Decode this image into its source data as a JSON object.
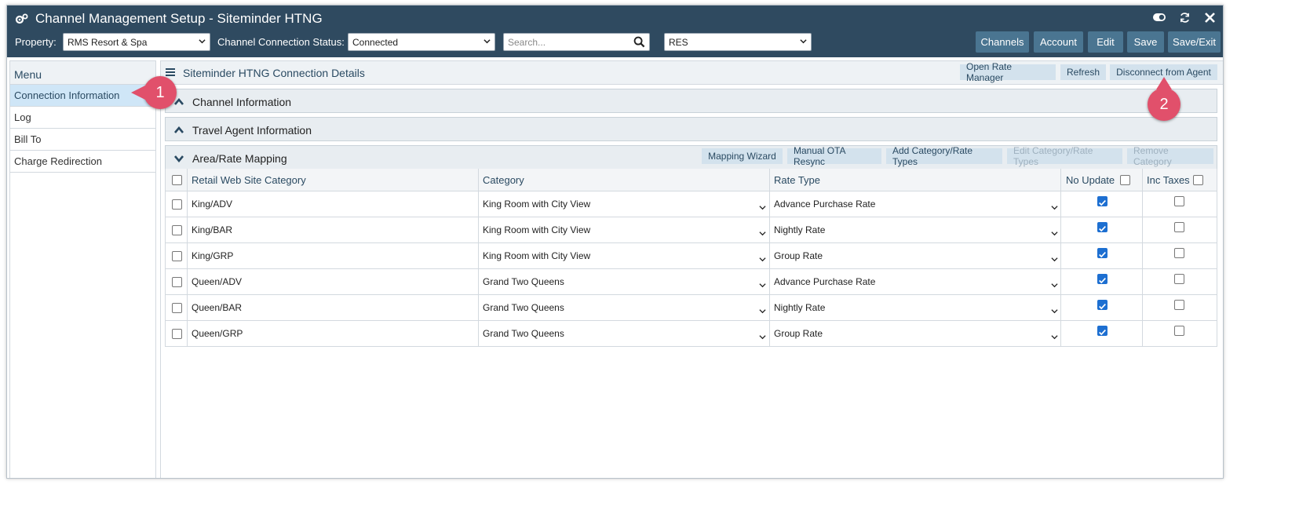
{
  "app": {
    "title": "Channel Management Setup - Siteminder HTNG"
  },
  "toolbar": {
    "property_label": "Property:",
    "property_value": "RMS Resort & Spa",
    "status_label": "Channel Connection Status:",
    "status_value": "Connected",
    "search_placeholder": "Search...",
    "res_value": "RES",
    "buttons": [
      "Channels",
      "Account",
      "Edit",
      "Save",
      "Save/Exit"
    ]
  },
  "sidebar": {
    "title": "Menu",
    "items": [
      {
        "label": "Connection Information"
      },
      {
        "label": "Log"
      },
      {
        "label": "Bill To"
      },
      {
        "label": "Charge Redirection"
      }
    ]
  },
  "main": {
    "title": "Siteminder HTNG Connection Details",
    "header_buttons": [
      "Open Rate Manager",
      "Refresh",
      "Disconnect from Agent"
    ],
    "sections": [
      {
        "title": "Channel Information"
      },
      {
        "title": "Travel Agent Information"
      },
      {
        "title": "Area/Rate Mapping"
      }
    ],
    "mapping_buttons": [
      "Mapping Wizard",
      "Manual OTA Resync",
      "Add Category/Rate Types",
      "Edit Category/Rate Types",
      "Remove Category"
    ],
    "table": {
      "columns": [
        "Retail Web Site Category",
        "Category",
        "Rate Type",
        "No Update",
        "Inc Taxes"
      ],
      "rows": [
        {
          "retail": "King/ADV",
          "category": "King Room with City View",
          "rate": "Advance Purchase Rate",
          "no_update": true,
          "inc_taxes": false
        },
        {
          "retail": "King/BAR",
          "category": "King Room with City View",
          "rate": "Nightly Rate",
          "no_update": true,
          "inc_taxes": false
        },
        {
          "retail": "King/GRP",
          "category": "King Room with City View",
          "rate": "Group Rate",
          "no_update": true,
          "inc_taxes": false
        },
        {
          "retail": "Queen/ADV",
          "category": "Grand Two Queens",
          "rate": "Advance Purchase Rate",
          "no_update": true,
          "inc_taxes": false
        },
        {
          "retail": "Queen/BAR",
          "category": "Grand Two Queens",
          "rate": "Nightly Rate",
          "no_update": true,
          "inc_taxes": false
        },
        {
          "retail": "Queen/GRP",
          "category": "Grand Two Queens",
          "rate": "Group Rate",
          "no_update": true,
          "inc_taxes": false
        }
      ]
    }
  },
  "annotations": [
    "1",
    "2"
  ],
  "colors": {
    "titlebar": "#2f4a60",
    "button": "#4a7591",
    "accent": "#e1506b",
    "checkbox": "#1d6fd1"
  }
}
